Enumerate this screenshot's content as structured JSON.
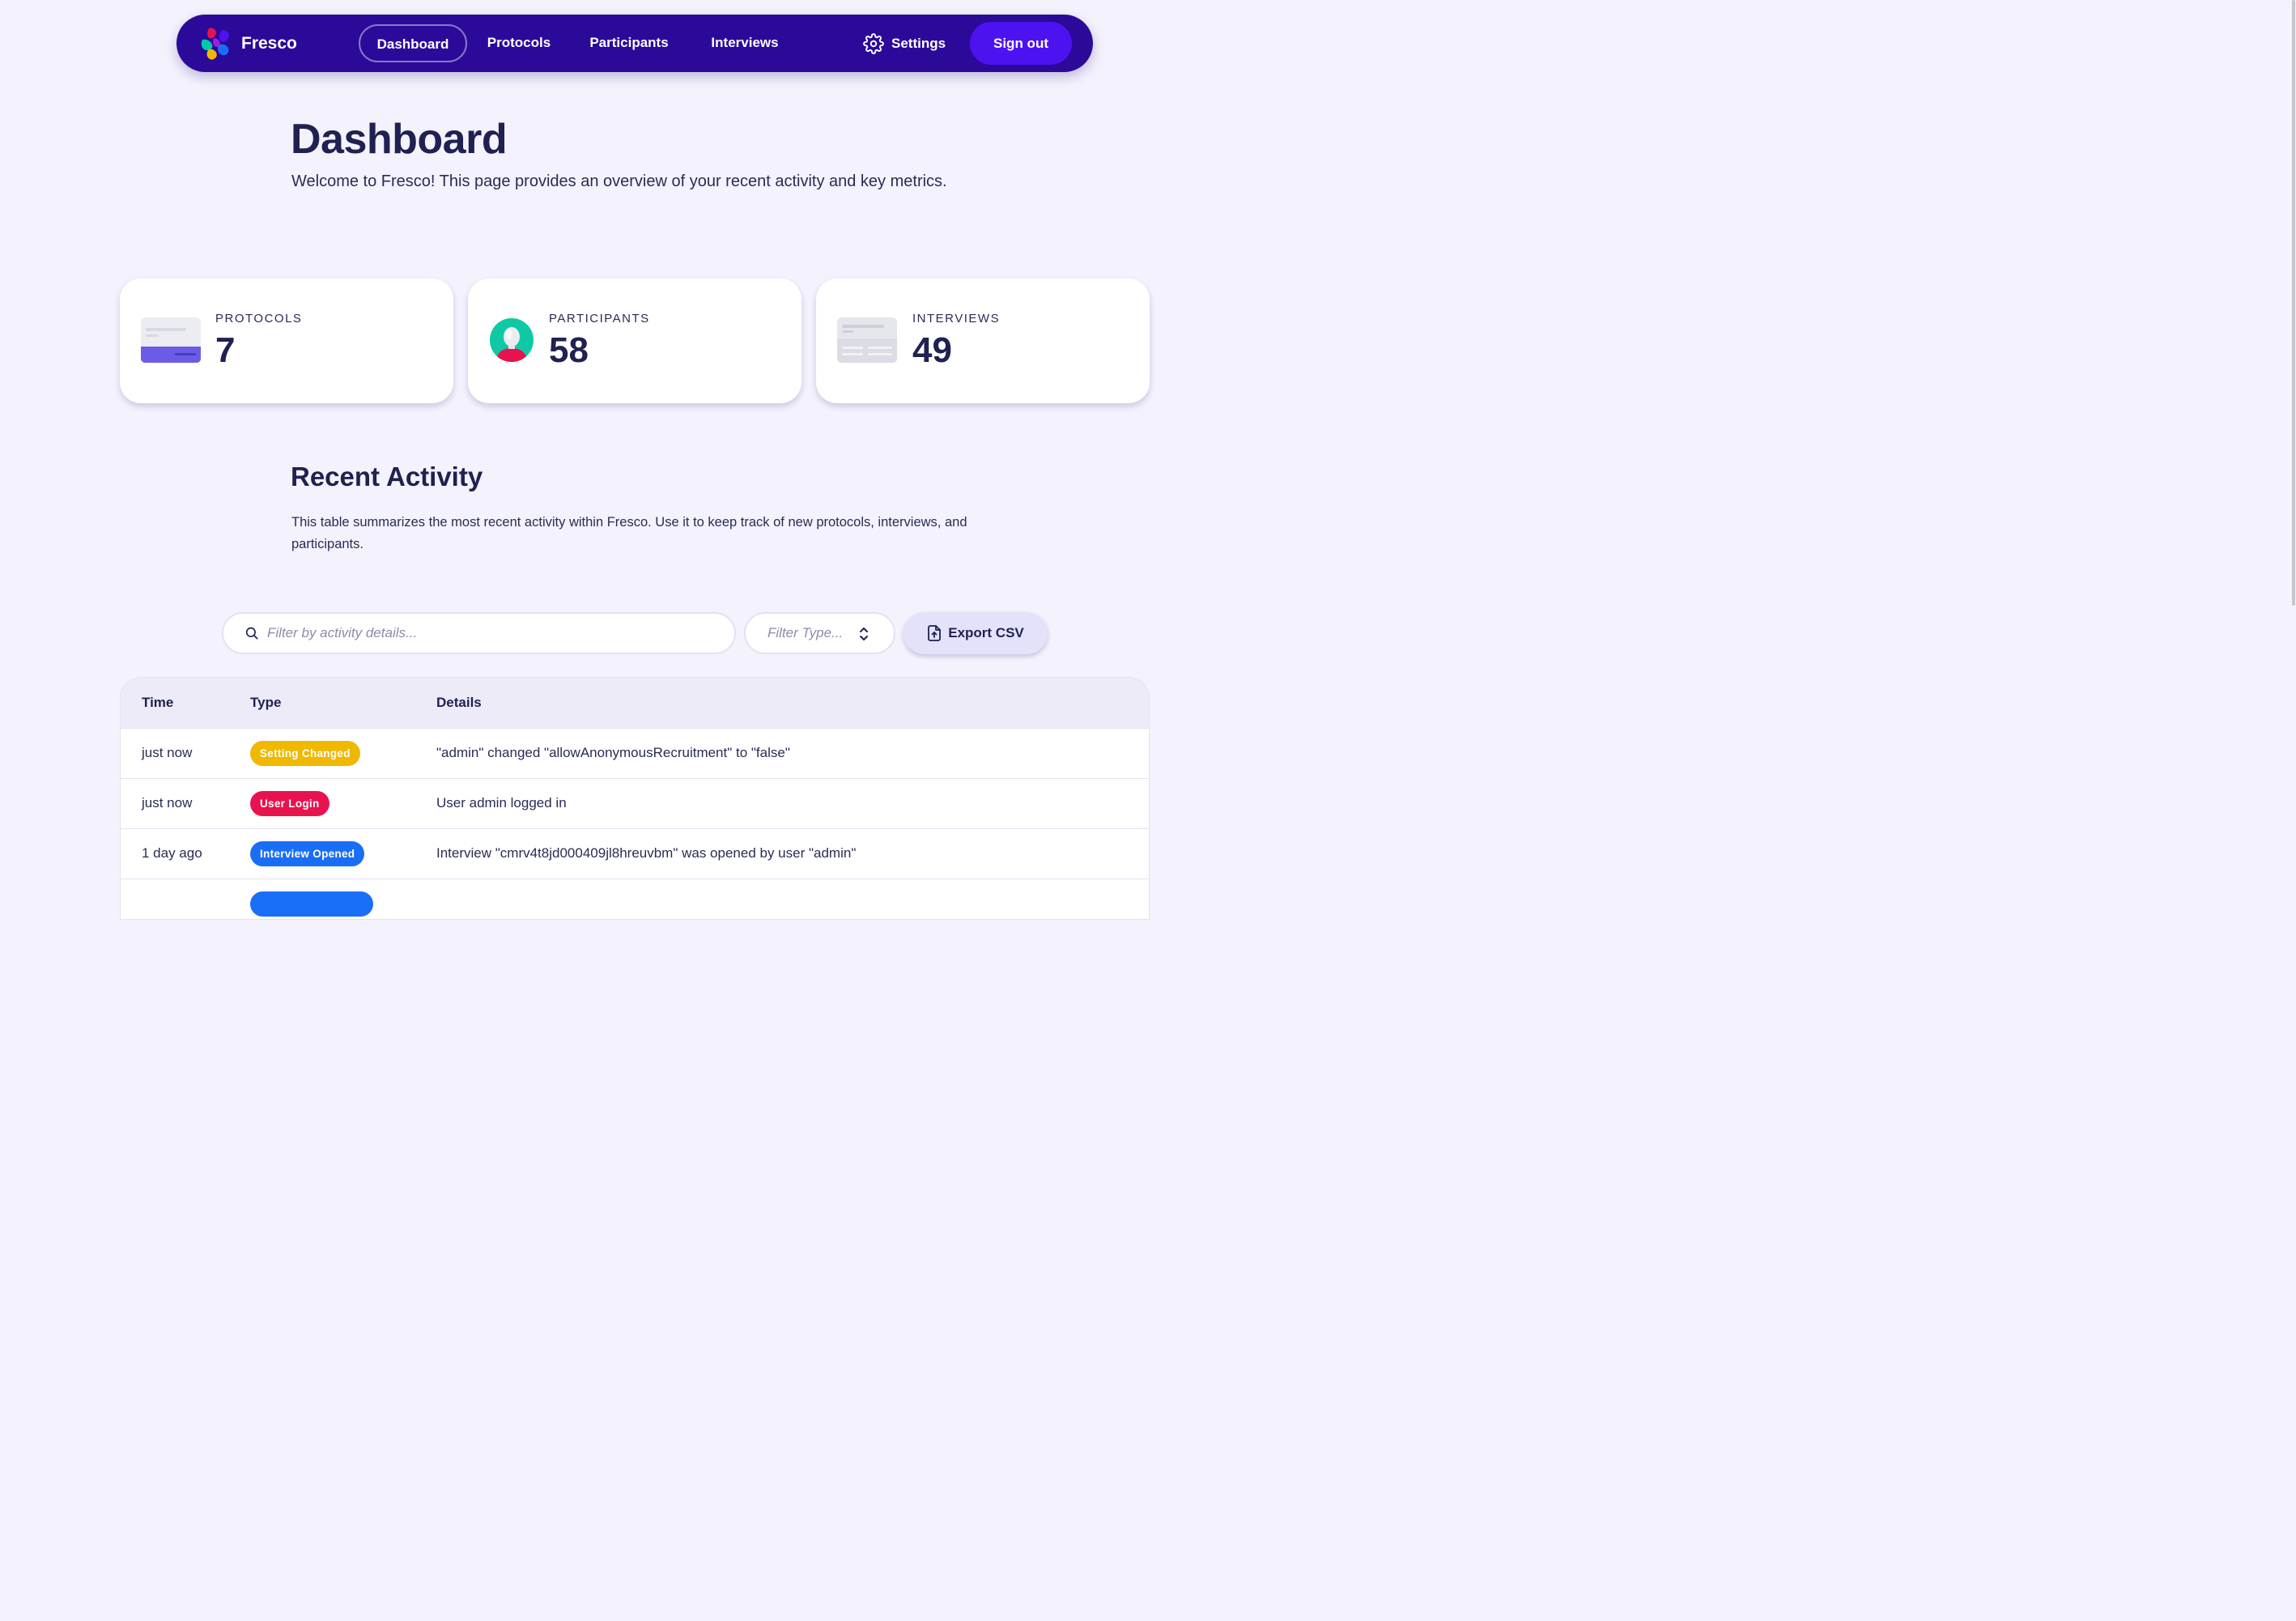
{
  "brand": {
    "name": "Fresco"
  },
  "nav": {
    "items": [
      {
        "label": "Dashboard",
        "active": true
      },
      {
        "label": "Protocols",
        "active": false
      },
      {
        "label": "Participants",
        "active": false
      },
      {
        "label": "Interviews",
        "active": false
      }
    ],
    "settings_label": "Settings",
    "settings_icon": "gear-icon",
    "signout_label": "Sign out"
  },
  "header": {
    "title": "Dashboard",
    "intro": "Welcome to Fresco! This page provides an overview of your recent activity and key metrics."
  },
  "stats": [
    {
      "label": "PROTOCOLS",
      "value": "7",
      "icon": "protocol-card-icon"
    },
    {
      "label": "PARTICIPANTS",
      "value": "58",
      "icon": "participant-avatar-icon"
    },
    {
      "label": "INTERVIEWS",
      "value": "49",
      "icon": "interview-card-icon"
    }
  ],
  "activity": {
    "title": "Recent Activity",
    "description": "This table summarizes the most recent activity within Fresco. Use it to keep track of new protocols, interviews, and participants.",
    "search_placeholder": "Filter by activity details...",
    "type_placeholder": "Filter Type...",
    "export_label": "Export CSV",
    "columns": [
      "Time",
      "Type",
      "Details"
    ],
    "rows": [
      {
        "time": "just now",
        "type": "Setting Changed",
        "type_color": "#f0b800",
        "details": "\"admin\" changed \"allowAnonymousRecruitment\" to \"false\""
      },
      {
        "time": "just now",
        "type": "User Login",
        "type_color": "#e8124f",
        "details": "User admin logged in"
      },
      {
        "time": "1 day ago",
        "type": "Interview Opened",
        "type_color": "#1a6ef5",
        "details": "Interview \"cmrv4t8jd000409jl8hreuvbm\" was opened by user \"admin\""
      },
      {
        "time": "",
        "type": "",
        "type_color": "#1a6ef5",
        "details": ""
      }
    ]
  },
  "colors": {
    "navbar": "#2b0a9a",
    "accent": "#4d12f0",
    "background": "#f3f2fd",
    "text": "#1f2151"
  }
}
